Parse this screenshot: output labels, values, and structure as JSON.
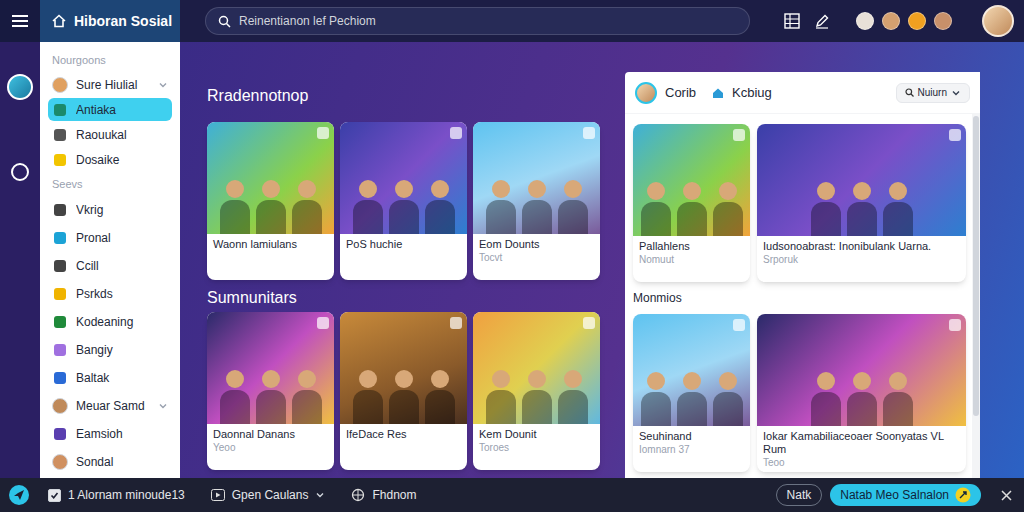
{
  "app": {
    "title": "Hiboran Sosial"
  },
  "search": {
    "placeholder": "Reinentianon lef Pechiom"
  },
  "sidebar": {
    "sections": [
      {
        "title": "Nourgoons",
        "items": [
          {
            "label": "Sure Hiulial",
            "kind": "avatar",
            "selected": false,
            "expandable": true,
            "color": "#e0a060"
          },
          {
            "label": "Antiaka",
            "kind": "glyph",
            "selected": true,
            "expandable": false,
            "color": "#1b8a6b"
          },
          {
            "label": "Raouukal",
            "kind": "glyph",
            "selected": false,
            "expandable": false,
            "color": "#555555"
          },
          {
            "label": "Dosaike",
            "kind": "glyph",
            "selected": false,
            "expandable": false,
            "color": "#f2c500"
          }
        ]
      },
      {
        "title": "Seevs",
        "items": [
          {
            "label": "Vkrig",
            "kind": "glyph",
            "selected": false,
            "expandable": false,
            "color": "#444444"
          },
          {
            "label": "Pronal",
            "kind": "glyph",
            "selected": false,
            "expandable": false,
            "color": "#1ca3d6"
          },
          {
            "label": "Ccill",
            "kind": "glyph",
            "selected": false,
            "expandable": false,
            "color": "#444444"
          },
          {
            "label": "Psrkds",
            "kind": "glyph",
            "selected": false,
            "expandable": false,
            "color": "#f0b400"
          },
          {
            "label": "Kodeaning",
            "kind": "glyph",
            "selected": false,
            "expandable": false,
            "color": "#1f8a3a"
          },
          {
            "label": "Bangiy",
            "kind": "glyph",
            "selected": false,
            "expandable": false,
            "color": "#a070e0"
          },
          {
            "label": "Baltak",
            "kind": "glyph",
            "selected": false,
            "expandable": false,
            "color": "#2a6ad6"
          },
          {
            "label": "Meuar Samd",
            "kind": "avatar",
            "selected": false,
            "expandable": true,
            "color": "#c08a5a"
          },
          {
            "label": "Eamsioh",
            "kind": "glyph",
            "selected": false,
            "expandable": false,
            "color": "#5a3fb0"
          },
          {
            "label": "Sondal",
            "kind": "avatar",
            "selected": false,
            "expandable": false,
            "color": "#d09060"
          }
        ]
      }
    ]
  },
  "main": {
    "sections": [
      {
        "title": "Rradennotnop",
        "cards": [
          {
            "title": "Waonn lamiulans"
          },
          {
            "title": "PoS huchie"
          },
          {
            "title": "Eom Dounts",
            "subtitle": "Tocvt"
          }
        ]
      },
      {
        "title": "Sumnunitars",
        "cards": [
          {
            "title": "Daonnal Danans",
            "subtitle": "Yeoo"
          },
          {
            "title": "IfeDace Res"
          },
          {
            "title": "Kem Dounit",
            "subtitle": "Toroes"
          }
        ]
      }
    ]
  },
  "panel": {
    "title": "Corib",
    "subtitle": "Kcbiug",
    "filter": "Nuiurn",
    "groups": [
      {
        "cards": [
          {
            "title": "Pallahlens",
            "subtitle": "Nomuut"
          },
          {
            "title": "Iudsonoabrast: Inonibulank Uarna.",
            "subtitle": "Srporuk"
          }
        ]
      },
      {
        "title": "Monmios",
        "cards": [
          {
            "title": "Seuhinand",
            "subtitle": "Iomnarn 37"
          },
          {
            "title": "Iokar Kamabiliaceoaer Soonyatas VL Rum",
            "subtitle": "Teoo"
          }
        ]
      }
    ]
  },
  "bottom_bar": {
    "left": [
      {
        "kind": "checkbox",
        "label": "1 Alornam minoude13",
        "checked": true
      },
      {
        "kind": "dropdown",
        "label": "Gpen Caulans"
      },
      {
        "kind": "link",
        "label": "Fhdnom"
      }
    ],
    "buttons": [
      {
        "label": "Natk",
        "kind": "outline"
      },
      {
        "label": "Natab Meo Salnalon",
        "kind": "primary"
      }
    ]
  }
}
